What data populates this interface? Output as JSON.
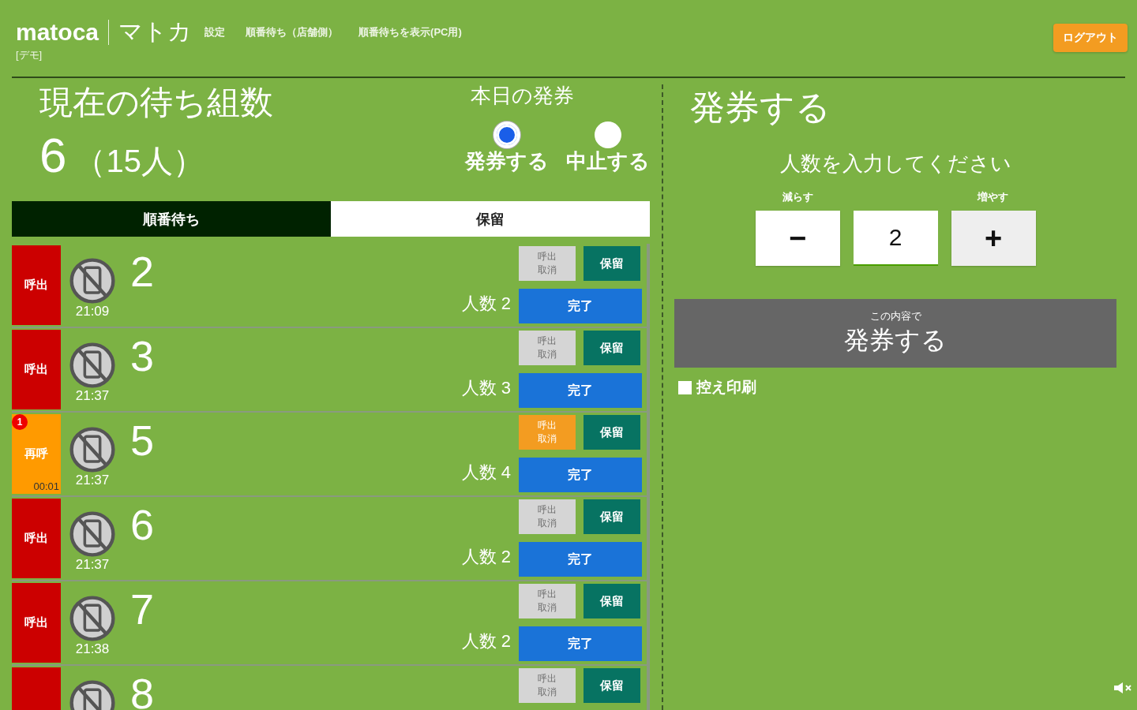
{
  "header": {
    "logo": "matoca",
    "logo_kana": "マトカ",
    "demo_label": "[デモ]",
    "nav": [
      "設定",
      "順番待ち（店舗側）",
      "順番待ちを表示(PC用)"
    ],
    "logout": "ログアウト"
  },
  "waiting": {
    "title": "現在の待ち組数",
    "count": "6",
    "people": "（15人）"
  },
  "ticketing": {
    "title": "本日の発券",
    "options": [
      {
        "label": "発券する",
        "selected": true
      },
      {
        "label": "中止する",
        "selected": false
      }
    ]
  },
  "tabs": [
    {
      "label": "順番待ち",
      "selected": true
    },
    {
      "label": "保留",
      "selected": false
    }
  ],
  "rows": [
    {
      "call_label": "呼出",
      "kind": "call",
      "time": "21:09",
      "number": "2",
      "people": "人数 2",
      "cancel_lines": [
        "呼出",
        "取消"
      ],
      "cancel_enabled": false,
      "hold": "保留",
      "done": "完了"
    },
    {
      "call_label": "呼出",
      "kind": "call",
      "time": "21:37",
      "number": "3",
      "people": "人数 3",
      "cancel_lines": [
        "呼出",
        "取消"
      ],
      "cancel_enabled": false,
      "hold": "保留",
      "done": "完了"
    },
    {
      "call_label": "再呼",
      "kind": "recall",
      "badge": "1",
      "timer": "00:01",
      "time": "21:37",
      "number": "5",
      "people": "人数 4",
      "cancel_lines": [
        "呼出",
        "取消"
      ],
      "cancel_enabled": true,
      "hold": "保留",
      "done": "完了"
    },
    {
      "call_label": "呼出",
      "kind": "call",
      "time": "21:37",
      "number": "6",
      "people": "人数 2",
      "cancel_lines": [
        "呼出",
        "取消"
      ],
      "cancel_enabled": false,
      "hold": "保留",
      "done": "完了"
    },
    {
      "call_label": "呼出",
      "kind": "call",
      "time": "21:38",
      "number": "7",
      "people": "人数 2",
      "cancel_lines": [
        "呼出",
        "取消"
      ],
      "cancel_enabled": false,
      "hold": "保留",
      "done": "完了"
    },
    {
      "kind": "call",
      "number": "8",
      "cancel_lines": [
        "呼出",
        "取消"
      ],
      "cancel_enabled": false,
      "hold": "保留"
    }
  ],
  "issue": {
    "title": "発券する",
    "prompt": "人数を入力してください",
    "decrease_label": "減らす",
    "increase_label": "増やす",
    "minus": "−",
    "value": "2",
    "plus": "+",
    "submit_caption": "この内容で",
    "submit": "発券する",
    "print_copy": {
      "label": "控え印刷",
      "checked": false
    }
  }
}
